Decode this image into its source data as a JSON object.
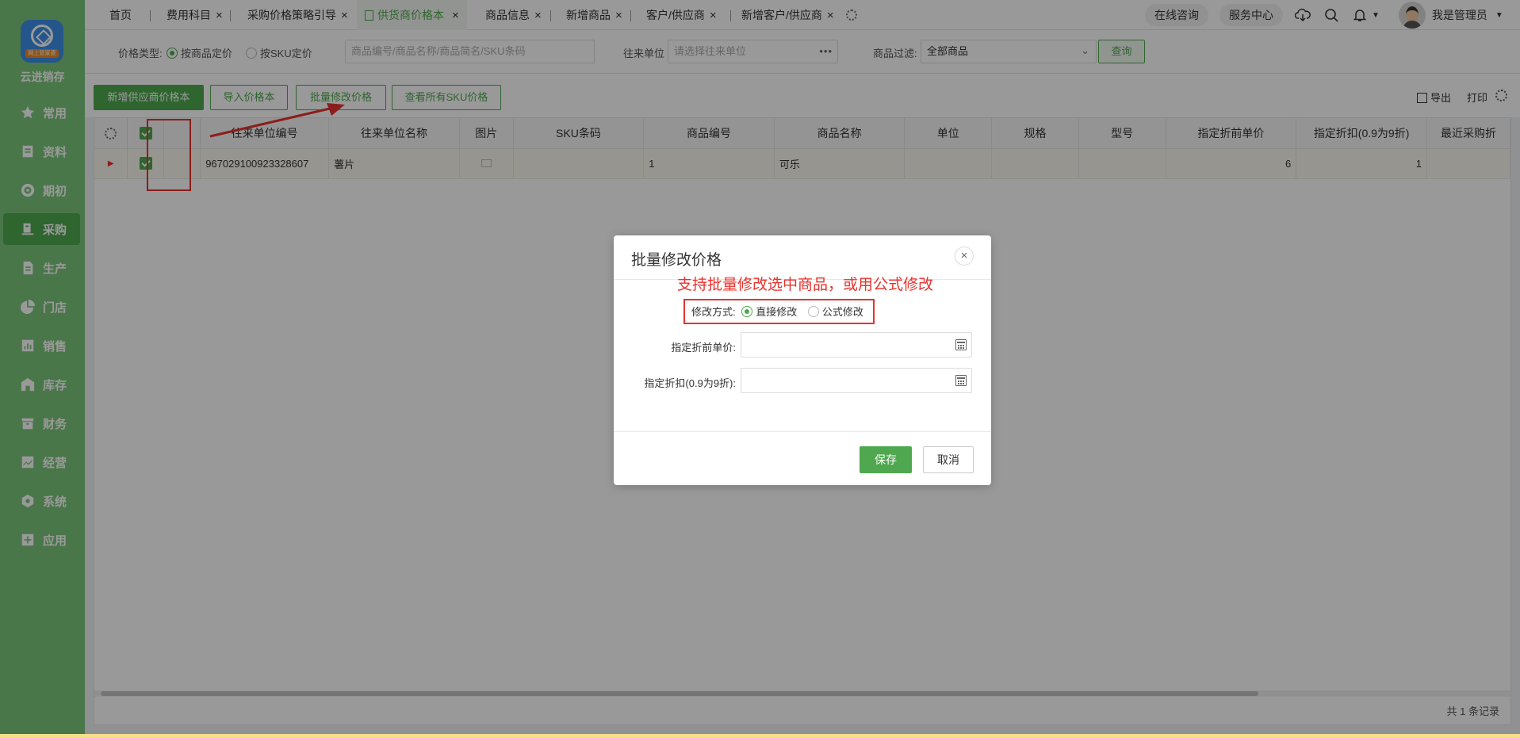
{
  "sidebar": {
    "brand": "云进销存",
    "logo_tag": "网上管家婆",
    "items": [
      {
        "label": "常用",
        "icon": "star-icon"
      },
      {
        "label": "资料",
        "icon": "document-icon"
      },
      {
        "label": "期初",
        "icon": "target-icon"
      },
      {
        "label": "采购",
        "icon": "purchase-icon",
        "active": true
      },
      {
        "label": "生产",
        "icon": "production-icon"
      },
      {
        "label": "门店",
        "icon": "pie-chart-icon"
      },
      {
        "label": "销售",
        "icon": "bar-chart-icon"
      },
      {
        "label": "库存",
        "icon": "warehouse-icon"
      },
      {
        "label": "财务",
        "icon": "finance-icon"
      },
      {
        "label": "经营",
        "icon": "trend-icon"
      },
      {
        "label": "系统",
        "icon": "settings-icon"
      },
      {
        "label": "应用",
        "icon": "plus-box-icon"
      }
    ]
  },
  "tabs": [
    {
      "label": "首页"
    },
    {
      "label": "费用科目"
    },
    {
      "label": "采购价格策略引导"
    },
    {
      "label": "供货商价格本"
    },
    {
      "label": "商品信息"
    },
    {
      "label": "新增商品"
    },
    {
      "label": "客户/供应商"
    },
    {
      "label": "新增客户/供应商"
    }
  ],
  "topbar": {
    "consult": "在线咨询",
    "service": "服务中心",
    "user": "我是管理员"
  },
  "filters": {
    "price_type_label": "价格类型:",
    "by_product": "按商品定价",
    "by_sku": "按SKU定价",
    "search_placeholder": "商品编号/商品名称/商品简名/SKU条码",
    "partner_label": "往来单位",
    "partner_placeholder": "请选择往来单位",
    "product_filter_label": "商品过滤:",
    "product_filter_value": "全部商品",
    "query": "查询"
  },
  "toolbar": {
    "add": "新增供应商价格本",
    "import": "导入价格本",
    "batch": "批量修改价格",
    "view_sku": "查看所有SKU价格",
    "export": "导出",
    "print": "打印"
  },
  "table": {
    "columns": [
      "往来单位编号",
      "往来单位名称",
      "图片",
      "SKU条码",
      "商品编号",
      "商品名称",
      "单位",
      "规格",
      "型号",
      "指定折前单价",
      "指定折扣(0.9为9折)",
      "最近采购折"
    ],
    "rows": [
      {
        "code": "967029100923328607",
        "name": "薯片",
        "image": "",
        "sku": "",
        "product_no": "1",
        "product_name": "可乐",
        "unit": "",
        "spec": "",
        "model": "",
        "price": "6",
        "discount": "1",
        "recent": ""
      }
    ],
    "total": "共 1 条记录"
  },
  "dialog": {
    "title": "批量修改价格",
    "note": "支持批量修改选中商品，或用公式修改",
    "mode_label": "修改方式:",
    "mode_direct": "直接修改",
    "mode_formula": "公式修改",
    "price_label": "指定折前单价:",
    "discount_label": "指定折扣(0.9为9折):",
    "save": "保存",
    "cancel": "取消"
  },
  "colors": {
    "primary": "#4fa84f",
    "sidebar": "#7cc67c",
    "annotation": "#e8322d"
  }
}
